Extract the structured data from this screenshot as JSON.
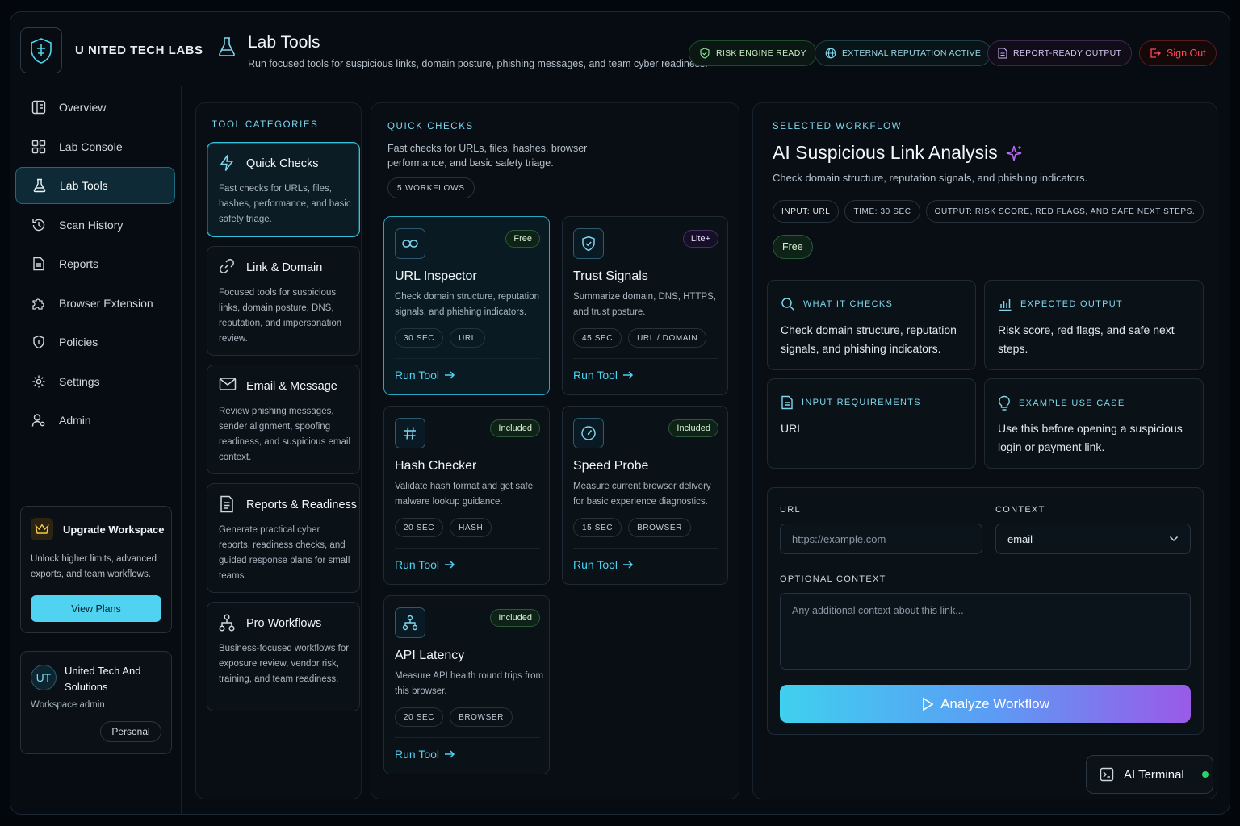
{
  "brand": {
    "name": "U NITED TECH LABS"
  },
  "header": {
    "title": "Lab Tools",
    "subtitle": "Run focused tools for suspicious links, domain posture, phishing messages, and team cyber readiness.",
    "status_pills": [
      "RISK ENGINE READY",
      "EXTERNAL REPUTATION ACTIVE",
      "REPORT-READY OUTPUT"
    ],
    "sign_out": "Sign Out"
  },
  "sidebar": {
    "items": [
      {
        "label": "Overview",
        "icon": "overview-icon"
      },
      {
        "label": "Lab Console",
        "icon": "grid-icon"
      },
      {
        "label": "Lab Tools",
        "icon": "flask-icon",
        "active": true
      },
      {
        "label": "Scan History",
        "icon": "history-icon"
      },
      {
        "label": "Reports",
        "icon": "document-icon"
      },
      {
        "label": "Browser Extension",
        "icon": "puzzle-icon"
      },
      {
        "label": "Policies",
        "icon": "shield-icon"
      },
      {
        "label": "Settings",
        "icon": "gear-icon"
      },
      {
        "label": "Admin",
        "icon": "admin-icon"
      }
    ],
    "upgrade": {
      "title": "Upgrade Workspace",
      "description": "Unlock higher limits, advanced exports, and team workflows.",
      "button": "View Plans"
    },
    "profile": {
      "initials": "UT",
      "name": "United Tech And Solutions",
      "role": "Workspace admin",
      "plan": "Personal"
    }
  },
  "categories": {
    "heading": "TOOL CATEGORIES",
    "items": [
      {
        "title": "Quick Checks",
        "description": "Fast checks for URLs, files, hashes, performance, and basic safety triage.",
        "active": true
      },
      {
        "title": "Link & Domain",
        "description": "Focused tools for suspicious links, domain posture, DNS, reputation, and impersonation review."
      },
      {
        "title": "Email & Message",
        "description": "Review phishing messages, sender alignment, spoofing readiness, and suspicious email context."
      },
      {
        "title": "Reports & Readiness",
        "description": "Generate practical cyber reports, readiness checks, and guided response plans for small teams."
      },
      {
        "title": "Pro Workflows",
        "description": "Business-focused workflows for exposure review, vendor risk, training, and team readiness."
      }
    ]
  },
  "quick_checks": {
    "heading": "QUICK CHECKS",
    "description": "Fast checks for URLs, files, hashes, browser performance, and basic safety triage.",
    "count": "5 WORKFLOWS",
    "run_label": "Run Tool",
    "tools": [
      {
        "title": "URL Inspector",
        "tag": "Free",
        "description": "Check domain structure, reputation signals, and phishing indicators.",
        "time": "30 SEC",
        "input": "URL"
      },
      {
        "title": "Trust Signals",
        "tag": "Lite+",
        "description": "Summarize domain, DNS, HTTPS, and trust posture.",
        "time": "45 SEC",
        "input": "URL / DOMAIN"
      },
      {
        "title": "Hash Checker",
        "tag": "Included",
        "description": "Validate hash format and get safe malware lookup guidance.",
        "time": "20 SEC",
        "input": "HASH"
      },
      {
        "title": "Speed Probe",
        "tag": "Included",
        "description": "Measure current browser delivery for basic experience diagnostics.",
        "time": "15 SEC",
        "input": "BROWSER"
      },
      {
        "title": "API Latency",
        "tag": "Included",
        "description": "Measure API health round trips from this browser.",
        "time": "20 SEC",
        "input": "BROWSER"
      }
    ]
  },
  "workflow": {
    "heading": "SELECTED WORKFLOW",
    "title": "AI Suspicious Link Analysis",
    "subtitle": "Check domain structure, reputation signals, and phishing indicators.",
    "chips": [
      "INPUT: URL",
      "TIME: 30 SEC",
      "OUTPUT: RISK SCORE, RED FLAGS, AND SAFE NEXT STEPS."
    ],
    "tier": "Free",
    "what_it_checks": {
      "label": "WHAT IT CHECKS",
      "value": "Check domain structure, reputation signals, and phishing indicators."
    },
    "expected_output": {
      "label": "EXPECTED OUTPUT",
      "value": "Risk score, red flags, and safe next steps."
    },
    "input_requirements": {
      "label": "INPUT REQUIREMENTS",
      "value": "URL"
    },
    "example_use_case": {
      "label": "EXAMPLE USE CASE",
      "value": "Use this before opening a suspicious login or payment link."
    },
    "form": {
      "url_label": "URL",
      "url_placeholder": "https://example.com",
      "context_label": "CONTEXT",
      "context_value": "email",
      "optional_label": "OPTIONAL CONTEXT",
      "optional_placeholder": "Any additional context about this link...",
      "submit": "Analyze Workflow"
    }
  },
  "terminal": {
    "label": "AI Terminal"
  },
  "colors": {
    "accent": "#4fd3f0",
    "danger": "#ff4a5e",
    "success": "#28d36a",
    "gradient_end": "#9a5ae8"
  }
}
